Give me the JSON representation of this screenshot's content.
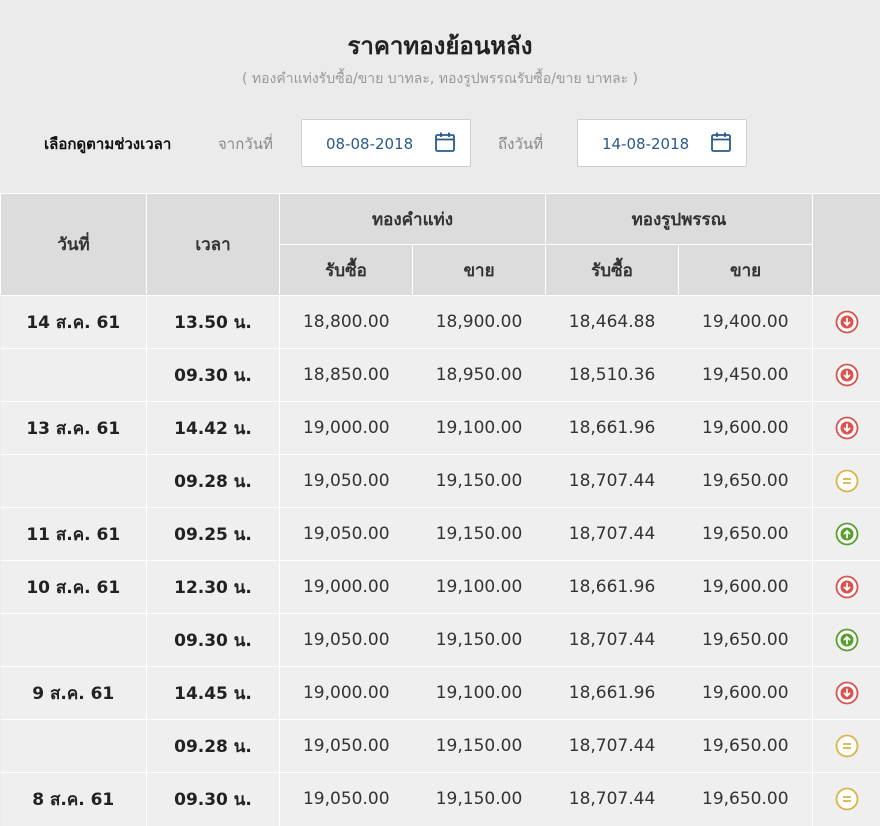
{
  "header": {
    "title": "ราคาทองย้อนหลัง",
    "subtitle": "( ทองคำแท่งรับซื้อ/ขาย บาทละ, ทองรูปพรรณรับซื้อ/ขาย บาทละ )"
  },
  "filter": {
    "label": "เลือกดูตามช่วงเวลา",
    "from_label": "จากวันที่",
    "from_value": "08-08-2018",
    "to_label": "ถึงวันที่",
    "to_value": "14-08-2018",
    "calendar_icon": "calendar-icon"
  },
  "table": {
    "headers": {
      "date": "วันที่",
      "time": "เวลา",
      "bar_gold": "ทองคำแท่ง",
      "jewelry_gold": "ทองรูปพรรณ",
      "buy": "รับซื้อ",
      "sell": "ขาย"
    },
    "status_colors": {
      "down": "#d9534f",
      "same": "#d9b44a",
      "up": "#5a9e2f"
    },
    "rows": [
      {
        "date": "14 ส.ค. 61",
        "time": "13.50 น.",
        "bar_buy": "18,800.00",
        "bar_sell": "18,900.00",
        "jew_buy": "18,464.88",
        "jew_sell": "19,400.00",
        "trend": "down"
      },
      {
        "date": "",
        "time": "09.30 น.",
        "bar_buy": "18,850.00",
        "bar_sell": "18,950.00",
        "jew_buy": "18,510.36",
        "jew_sell": "19,450.00",
        "trend": "down"
      },
      {
        "date": "13 ส.ค. 61",
        "time": "14.42 น.",
        "bar_buy": "19,000.00",
        "bar_sell": "19,100.00",
        "jew_buy": "18,661.96",
        "jew_sell": "19,600.00",
        "trend": "down"
      },
      {
        "date": "",
        "time": "09.28 น.",
        "bar_buy": "19,050.00",
        "bar_sell": "19,150.00",
        "jew_buy": "18,707.44",
        "jew_sell": "19,650.00",
        "trend": "same"
      },
      {
        "date": "11 ส.ค. 61",
        "time": "09.25 น.",
        "bar_buy": "19,050.00",
        "bar_sell": "19,150.00",
        "jew_buy": "18,707.44",
        "jew_sell": "19,650.00",
        "trend": "up"
      },
      {
        "date": "10 ส.ค. 61",
        "time": "12.30 น.",
        "bar_buy": "19,000.00",
        "bar_sell": "19,100.00",
        "jew_buy": "18,661.96",
        "jew_sell": "19,600.00",
        "trend": "down"
      },
      {
        "date": "",
        "time": "09.30 น.",
        "bar_buy": "19,050.00",
        "bar_sell": "19,150.00",
        "jew_buy": "18,707.44",
        "jew_sell": "19,650.00",
        "trend": "up"
      },
      {
        "date": "9 ส.ค. 61",
        "time": "14.45 น.",
        "bar_buy": "19,000.00",
        "bar_sell": "19,100.00",
        "jew_buy": "18,661.96",
        "jew_sell": "19,600.00",
        "trend": "down"
      },
      {
        "date": "",
        "time": "09.28 น.",
        "bar_buy": "19,050.00",
        "bar_sell": "19,150.00",
        "jew_buy": "18,707.44",
        "jew_sell": "19,650.00",
        "trend": "same"
      },
      {
        "date": "8 ส.ค. 61",
        "time": "09.30 น.",
        "bar_buy": "19,050.00",
        "bar_sell": "19,150.00",
        "jew_buy": "18,707.44",
        "jew_sell": "19,650.00",
        "trend": "same"
      }
    ]
  }
}
